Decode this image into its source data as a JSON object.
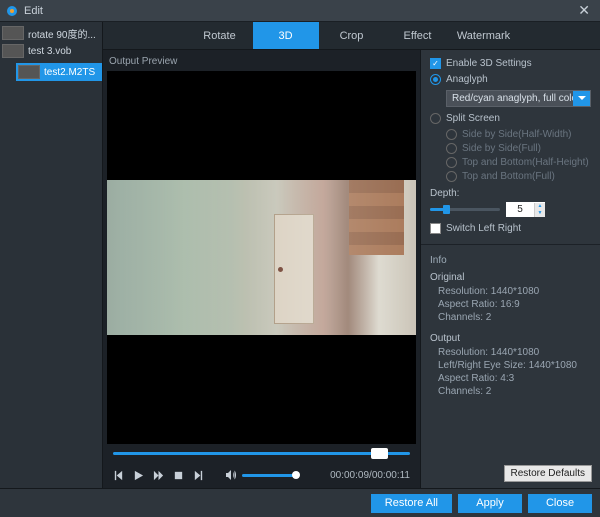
{
  "window": {
    "title": "Edit"
  },
  "sidebar": {
    "files": [
      {
        "name": "rotate 90度的..."
      },
      {
        "name": "test 3.vob"
      },
      {
        "name": "test2.M2TS"
      }
    ],
    "selected": 2
  },
  "tabs": {
    "items": [
      "Rotate",
      "3D",
      "Crop",
      "Effect",
      "Watermark"
    ],
    "active": 1
  },
  "preview": {
    "label": "Output Preview",
    "elapsed": "00:00:09",
    "total": "00:00:11"
  },
  "panel3d": {
    "enable_label": "Enable 3D Settings",
    "enable": true,
    "mode": "anaglyph",
    "anaglyph_label": "Anaglyph",
    "anaglyph_select": "Red/cyan anaglyph, full color",
    "split_label": "Split Screen",
    "split_options": [
      "Side by Side(Half-Width)",
      "Side by Side(Full)",
      "Top and Bottom(Half-Height)",
      "Top and Bottom(Full)"
    ],
    "depth_label": "Depth:",
    "depth_value": "5",
    "switch_label": "Switch Left Right",
    "switch": false
  },
  "info": {
    "header": "Info",
    "original_label": "Original",
    "original": {
      "resolution": "Resolution: 1440*1080",
      "aspect": "Aspect Ratio: 16:9",
      "channels": "Channels: 2"
    },
    "output_label": "Output",
    "output": {
      "resolution": "Resolution: 1440*1080",
      "eyesize": "Left/Right Eye Size: 1440*1080",
      "aspect": "Aspect Ratio: 4:3",
      "channels": "Channels: 2"
    },
    "restore_defaults": "Restore Defaults"
  },
  "footer": {
    "restore_all": "Restore All",
    "apply": "Apply",
    "close": "Close"
  }
}
